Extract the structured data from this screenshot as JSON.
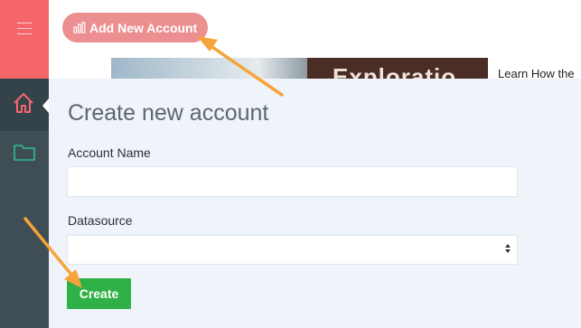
{
  "header": {
    "add_account_label": "Add New Account",
    "add_account_icon": "bar-chart-icon",
    "menu_icon": "hamburger-menu-icon"
  },
  "sidebar": {
    "items": [
      {
        "icon": "home-icon",
        "active": true
      },
      {
        "icon": "folder-icon",
        "active": false
      }
    ]
  },
  "background": {
    "banner_text": "Exploratio",
    "learn_text": "Learn How the"
  },
  "form": {
    "title": "Create new account",
    "account_name_label": "Account Name",
    "account_name_value": "",
    "datasource_label": "Datasource",
    "datasource_value": "",
    "create_label": "Create"
  },
  "colors": {
    "accent_red": "#f4666a",
    "add_button": "#ec8f90",
    "sidebar": "#3f4e55",
    "create_green": "#2fb147",
    "panel_bg": "#eff3fa",
    "annotation_arrow": "#f6a43a"
  }
}
